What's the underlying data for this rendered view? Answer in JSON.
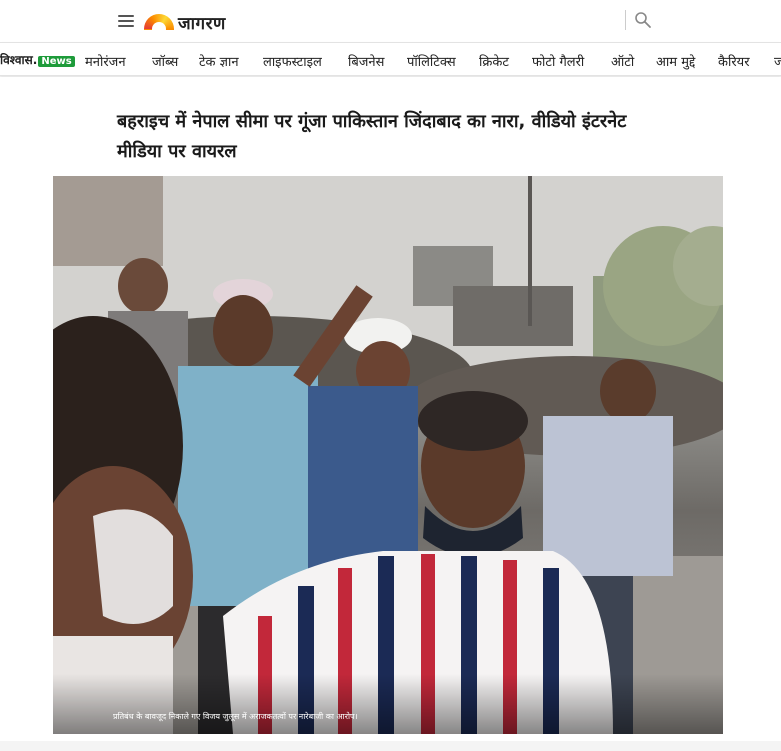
{
  "header": {
    "logo_text": "जागरण",
    "menu_icon": "hamburger-menu-icon",
    "search_icon": "search-icon"
  },
  "nav": {
    "badge_text": "विश्वास.",
    "badge_news": "News",
    "items": [
      "मनोरंजन",
      "जॉब्स",
      "टेक ज्ञान",
      "लाइफस्टाइल",
      "बिजनेस",
      "पॉलिटिक्स",
      "क्रिकेट",
      "फोटो गैलरी",
      "ऑटो",
      "आम मुद्दे",
      "कैरियर",
      "ज"
    ]
  },
  "article": {
    "headline": "बहराइच में नेपाल सीमा पर गूंजा पाकिस्तान जिंदाबाद का नारा, वीडियो इंटरनेट मीडिया पर वायरल",
    "photo_caption": "प्रतिबंध के बावजूद निकाले गए विजय जुलूस में अराजकतत्वों पर नारेबाजी का आरोप।"
  },
  "colors": {
    "news_badge": "#1e9b3a",
    "logo_sun": [
      "#e53935",
      "#fb8c00",
      "#fdd835"
    ]
  }
}
